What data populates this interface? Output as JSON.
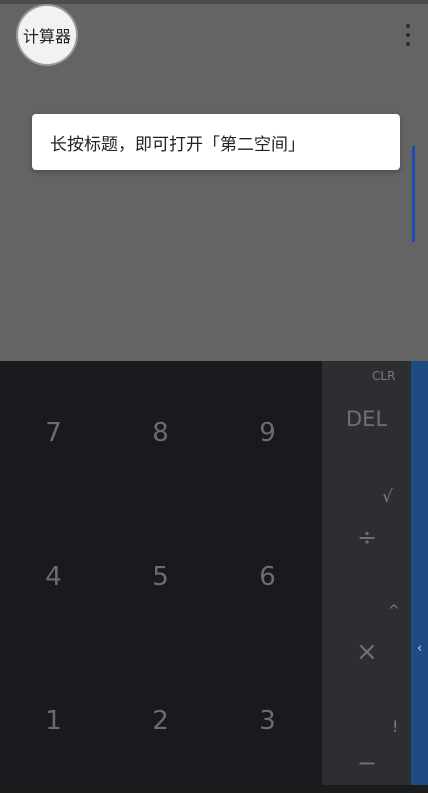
{
  "app": {
    "title": "计算器"
  },
  "tip": {
    "text": "长按标题，即可打开「第二空间」"
  },
  "keypad": {
    "keys": [
      "7",
      "8",
      "9",
      "4",
      "5",
      "6",
      "1",
      "2",
      "3"
    ]
  },
  "operators": {
    "clr": "CLR",
    "del": "DEL",
    "sqrt": "√",
    "divide": "÷",
    "power": "^",
    "multiply": "×",
    "factorial": "!",
    "minus": "−"
  },
  "side_panel": {
    "chevron": "‹"
  },
  "colors": {
    "display_bg": "#646464",
    "keypad_bg": "#181a1d",
    "operators_bg": "#2c2e31",
    "side_panel_bg": "#1f4a82",
    "accent": "#1c4fb0"
  }
}
